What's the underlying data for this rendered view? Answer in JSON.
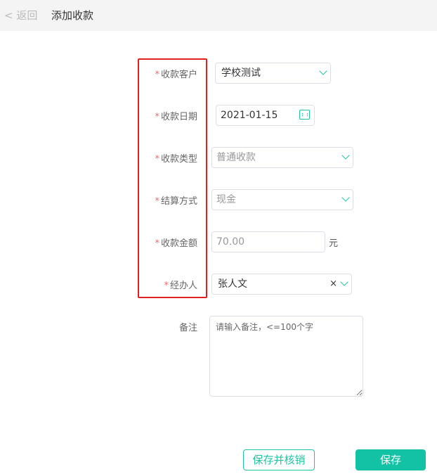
{
  "header": {
    "back_label": "返回",
    "title": "添加收款"
  },
  "form": {
    "customer": {
      "label": "收款客户",
      "value": "学校测试"
    },
    "date": {
      "label": "收款日期",
      "value": "2021-01-15"
    },
    "type": {
      "label": "收款类型",
      "placeholder": "普通收款"
    },
    "settlement": {
      "label": "结算方式",
      "placeholder": "现金"
    },
    "amount": {
      "label": "收款金额",
      "placeholder": "70.00",
      "unit": "元"
    },
    "handler": {
      "label": "经办人",
      "value": "张人文",
      "clear": "×"
    },
    "remark": {
      "label": "备注",
      "placeholder": "请输入备注，<=100个字"
    },
    "required_mark": "*"
  },
  "actions": {
    "save_and_verify": "保存并核销",
    "save": "保存"
  },
  "colors": {
    "accent": "#13c2a4",
    "required": "#f56c6c",
    "highlight_box": "#e02020"
  }
}
